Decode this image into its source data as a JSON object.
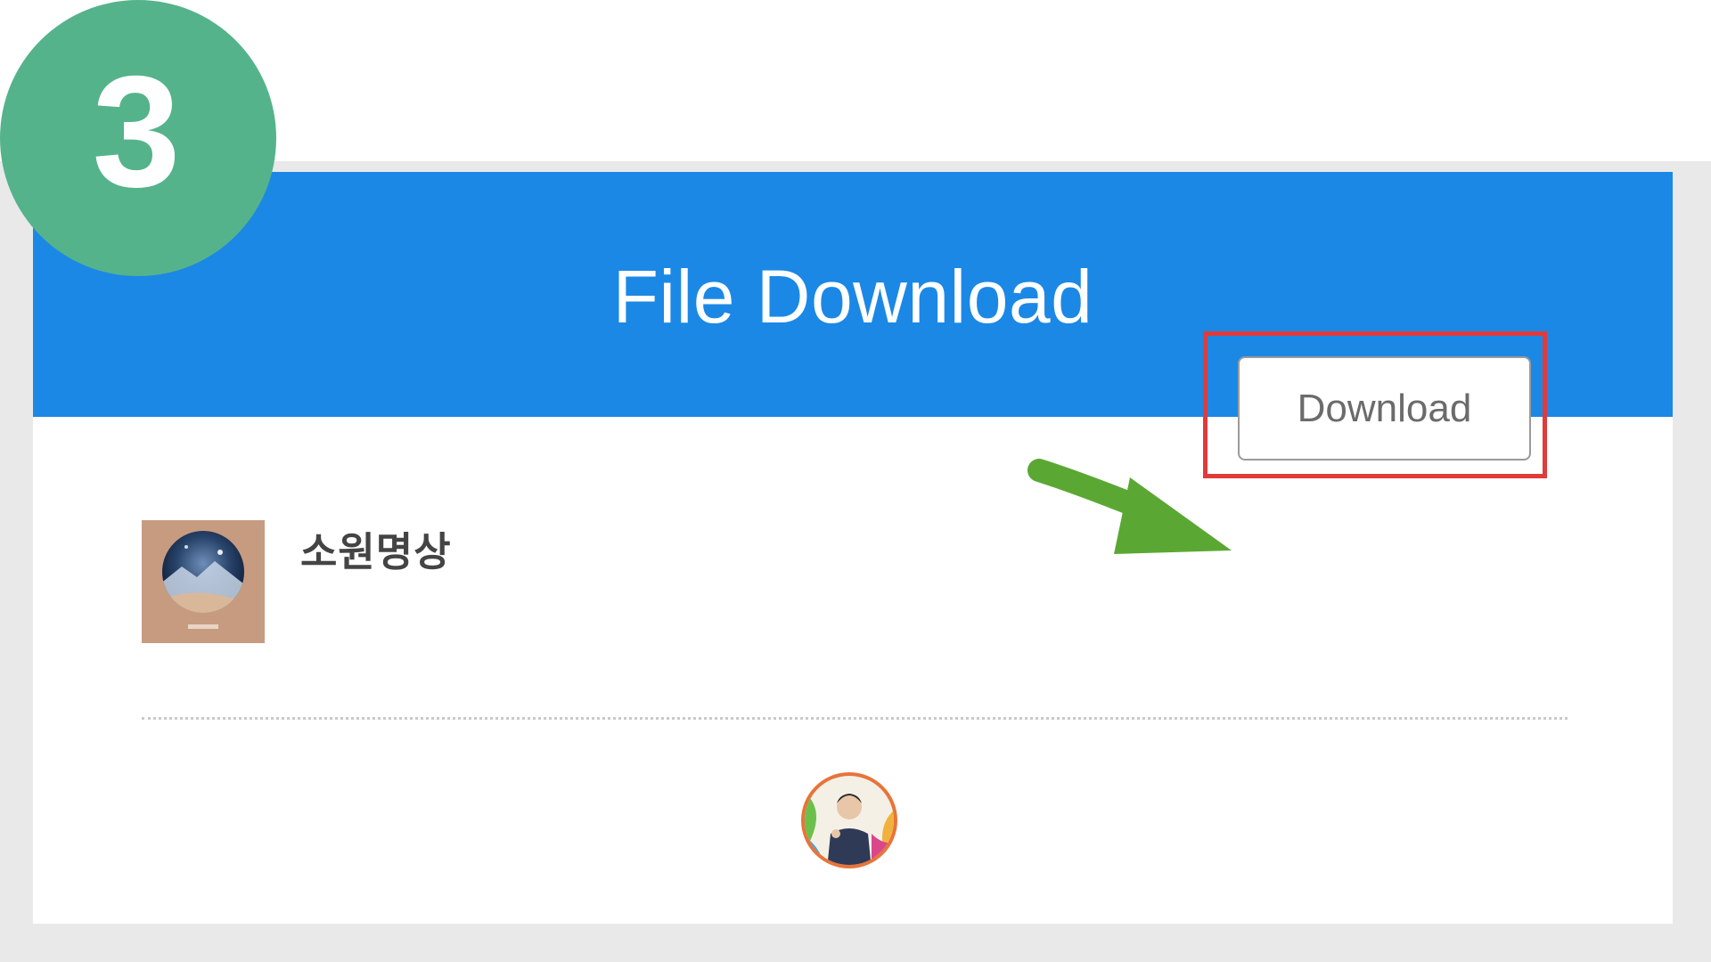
{
  "step": {
    "number": "3"
  },
  "dialog": {
    "title": "File Download"
  },
  "file": {
    "name": "소원명상",
    "download_label": "Download"
  },
  "colors": {
    "header": "#1b88e6",
    "badge": "#55b38b",
    "highlight": "#e03b3b",
    "arrow": "#5aa833",
    "backdrop": "#e9e9e9"
  },
  "icons": {
    "thumbnail": "album-cover-thumbnail",
    "arrow": "green-arrow-icon",
    "avatar": "profile-avatar"
  }
}
